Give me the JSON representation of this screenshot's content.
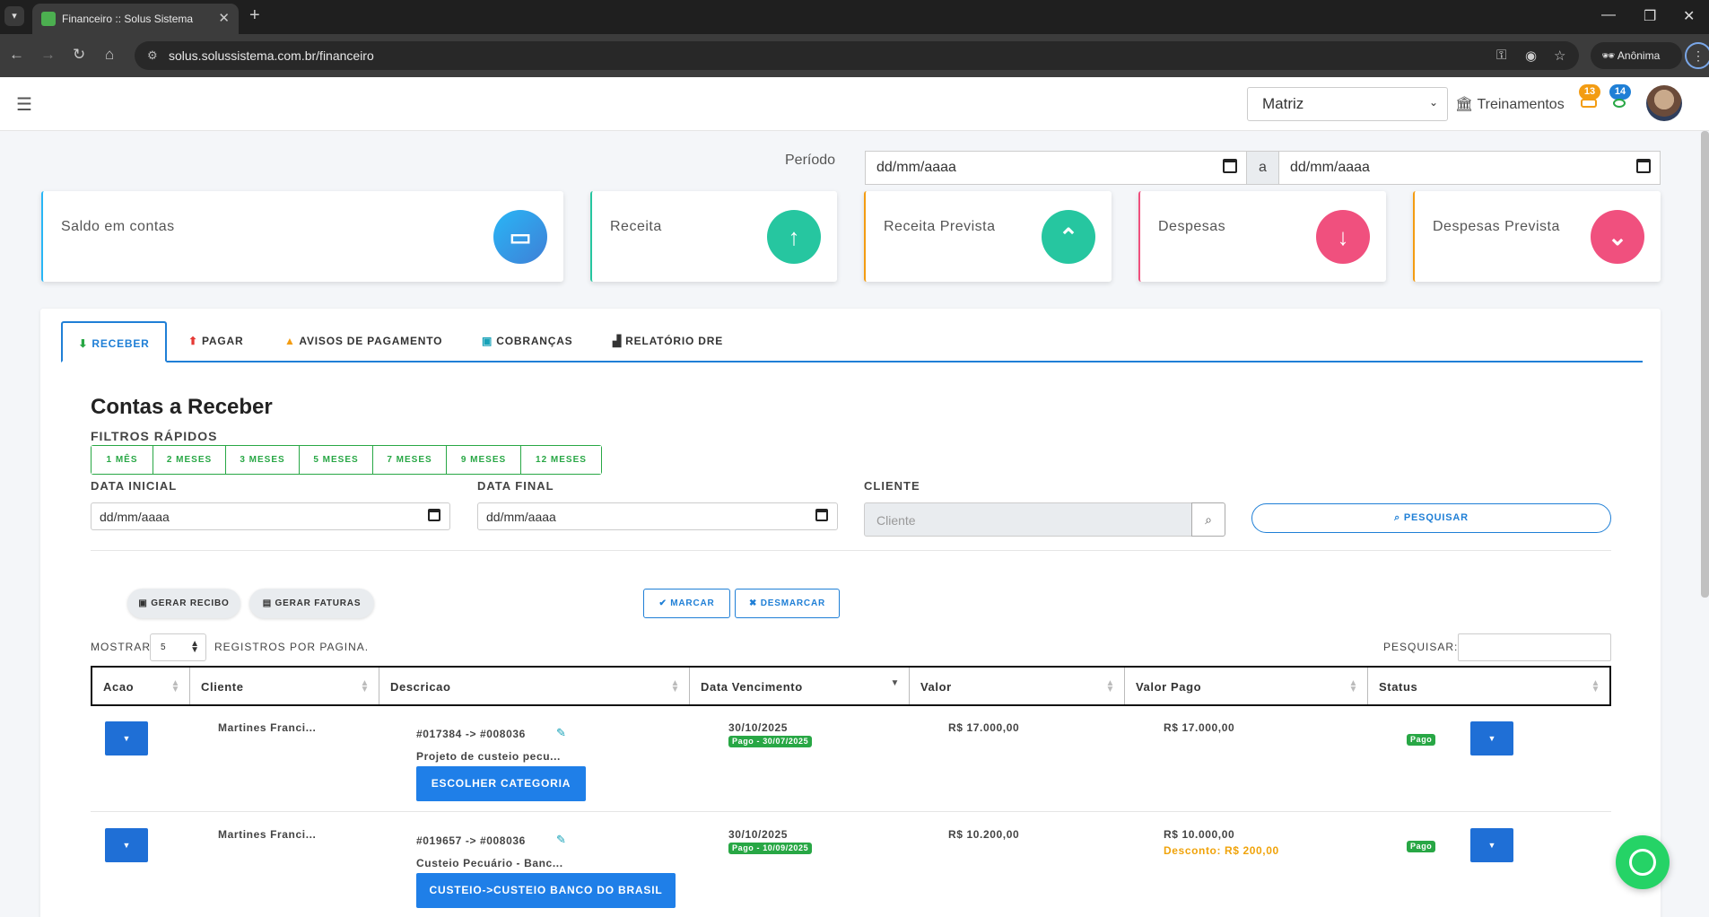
{
  "browser": {
    "tab_title": "Financeiro :: Solus Sistema",
    "url": "solus.solussistema.com.br/financeiro",
    "profile_label": "Anônima"
  },
  "header": {
    "branch_select": "Matriz",
    "treinamentos_label": "Treinamentos",
    "notif_orange_count": "13",
    "notif_blue_count": "14"
  },
  "periodo": {
    "label": "Período",
    "start_placeholder": "dd/mm/aaaa",
    "separator": "a",
    "end_placeholder": "dd/mm/aaaa"
  },
  "cards": [
    {
      "label": "Saldo em contas",
      "icon": "wallet-icon",
      "color": "#29b6f6"
    },
    {
      "label": "Receita",
      "icon": "arrow-up-icon",
      "color": "#26c6a0"
    },
    {
      "label": "Receita Prevista",
      "icon": "chevron-up-circle-icon",
      "color": "#26c6a0"
    },
    {
      "label": "Despesas",
      "icon": "arrow-down-icon",
      "color": "#f0507e"
    },
    {
      "label": "Despesas Prevista",
      "icon": "chevron-down-circle-icon",
      "color": "#f0507e"
    }
  ],
  "tabs": [
    {
      "label": "RECEBER",
      "icon": "arrow-down-icon"
    },
    {
      "label": "PAGAR",
      "icon": "arrow-up-icon"
    },
    {
      "label": "AVISOS DE PAGAMENTO",
      "icon": "warning-icon"
    },
    {
      "label": "COBRANÇAS",
      "icon": "money-icon"
    },
    {
      "label": "RELATÓRIO DRE",
      "icon": "bar-chart-icon"
    }
  ],
  "main": {
    "title": "Contas a Receber",
    "filtros_label": "FILTROS RÁPIDOS",
    "filtros": [
      "1 MÊS",
      "2 MESES",
      "3 MESES",
      "5 MESES",
      "7 MESES",
      "9 MESES",
      "12 MESES"
    ],
    "data_inicial_label": "DATA INICIAL",
    "data_final_label": "DATA FINAL",
    "cliente_label": "CLIENTE",
    "date_placeholder": "dd/mm/aaaa",
    "cliente_placeholder": "Cliente",
    "pesquisar_button": "PESQUISAR",
    "gerar_recibo": "GERAR RECIBO",
    "gerar_faturas": "GERAR FATURAS",
    "marcar": "MARCAR",
    "desmarcar": "DESMARCAR",
    "mostrar_label": "MOSTRAR",
    "mostrar_value": "5",
    "registros_label": "REGISTROS POR PAGINA.",
    "pesquisar_label": "PESQUISAR:"
  },
  "table": {
    "columns": [
      "Acao",
      "Cliente",
      "Descricao",
      "Data Vencimento",
      "Valor",
      "Valor Pago",
      "Status"
    ],
    "rows": [
      {
        "cliente": "Martines Franci...",
        "descricao_id": "#017384 -> #008036",
        "descricao_text": "Projeto de custeio pecu...",
        "categoria": "ESCOLHER CATEGORIA",
        "vencimento": "30/10/2025",
        "pago_badge": "Pago - 30/07/2025",
        "valor": "R$ 17.000,00",
        "valor_pago": "R$ 17.000,00",
        "desconto": "",
        "status": "Pago"
      },
      {
        "cliente": "Martines Franci...",
        "descricao_id": "#019657 -> #008036",
        "descricao_text": "Custeio Pecuário - Banc...",
        "categoria": "CUSTEIO->CUSTEIO BANCO DO BRASIL",
        "vencimento": "30/10/2025",
        "pago_badge": "Pago - 10/09/2025",
        "valor": "R$ 10.200,00",
        "valor_pago": "R$ 10.000,00",
        "desconto": "Desconto: R$ 200,00",
        "status": "Pago"
      }
    ]
  }
}
